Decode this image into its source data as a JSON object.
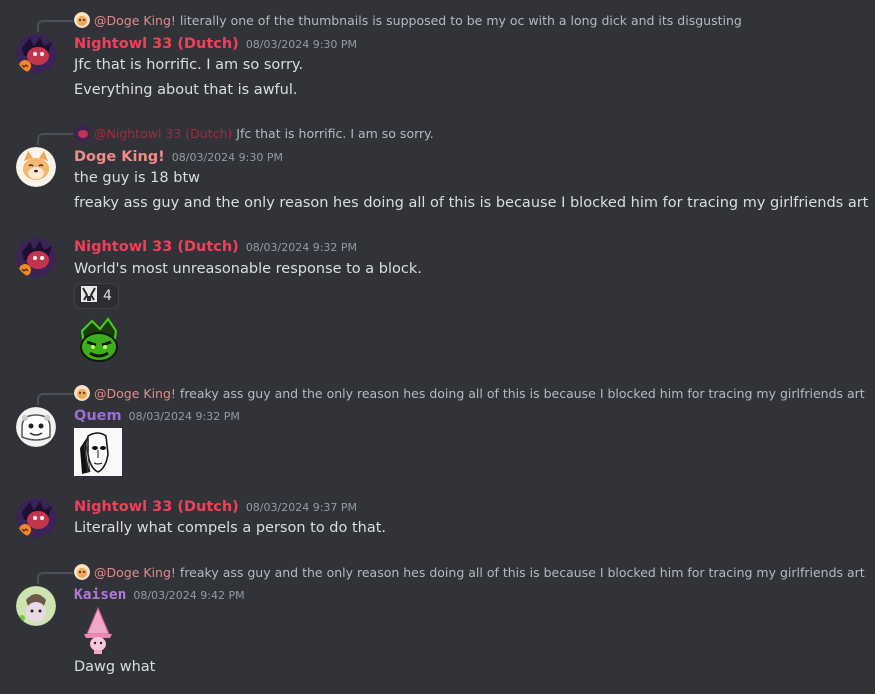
{
  "messages": [
    {
      "reply": {
        "mention": "@Doge King!",
        "mention_color": "#e58b8b",
        "preview": "literally one of the thumbnails is supposed to be my oc with a long dick and its disgusting"
      },
      "author": "Nightowl 33 (Dutch)",
      "author_color": "#f23f5b",
      "timestamp": "08/03/2024 9:30 PM",
      "lines": [
        "Jfc that is horrific. I am so sorry.",
        "Everything about that is awful."
      ]
    },
    {
      "reply": {
        "mention": "@Nightowl 33 (Dutch)",
        "mention_color": "#a12b40",
        "preview": "Jfc that is horrific. I am so sorry."
      },
      "author": "Doge King!",
      "author_color": "#f08c8c",
      "timestamp": "08/03/2024 9:30 PM",
      "lines": [
        "the guy is 18 btw",
        "freaky ass guy and the only reason hes doing all of this is because I blocked him for tracing my girlfriends art"
      ]
    },
    {
      "author": "Nightowl 33 (Dutch)",
      "author_color": "#f23f5b",
      "timestamp": "08/03/2024 9:32 PM",
      "lines": [
        "World's most unreasonable response to a block."
      ],
      "reaction": {
        "emoji": "custom-emoji",
        "count": "4"
      },
      "attachment": "green-sticker-image"
    },
    {
      "reply": {
        "mention": "@Doge King!",
        "mention_color": "#e58b8b",
        "preview": "freaky ass guy and the only reason hes doing all of this is because I blocked him for tracing my girlfriends art"
      },
      "author": "Quem",
      "author_color": "#9b6fd1",
      "timestamp": "08/03/2024 9:32 PM",
      "attachment": "face-sketch-image"
    },
    {
      "author": "Nightowl 33 (Dutch)",
      "author_color": "#f23f5b",
      "timestamp": "08/03/2024 9:37 PM",
      "lines": [
        "Literally what compels a person to do that."
      ]
    },
    {
      "reply": {
        "mention": "@Doge King!",
        "mention_color": "#e58b8b",
        "preview": "freaky ass guy and the only reason hes doing all of this is because I blocked him for tracing my girlfriends art"
      },
      "author": "Kaisen",
      "author_color": "#b07ad9",
      "timestamp": "08/03/2024 9:42 PM",
      "attachment": "pink-cone-image",
      "lines": [
        "Dawg what"
      ]
    }
  ]
}
